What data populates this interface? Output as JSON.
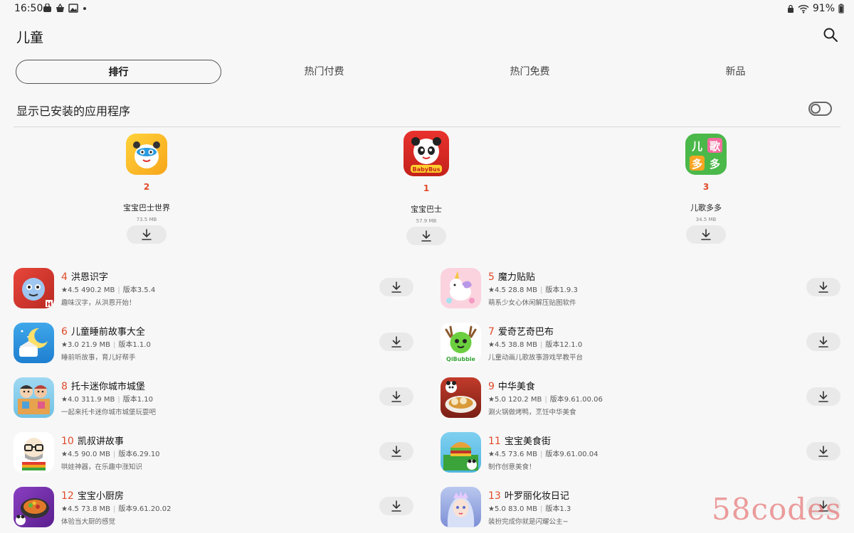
{
  "status_bar": {
    "time": "16:50",
    "battery": "91%"
  },
  "header": {
    "title": "儿童"
  },
  "tabs": [
    {
      "label": "排行",
      "active": true
    },
    {
      "label": "热门付费",
      "active": false
    },
    {
      "label": "热门免费",
      "active": false
    },
    {
      "label": "新品",
      "active": false
    }
  ],
  "toggle_row": {
    "label": "显示已安装的应用程序",
    "enabled": false
  },
  "top3": [
    {
      "rank": "2",
      "name": "宝宝巴士世界",
      "size": "73.5 MB"
    },
    {
      "rank": "1",
      "name": "宝宝巴士",
      "size": "57.9 MB"
    },
    {
      "rank": "3",
      "name": "儿歌多多",
      "size": "34.5 MB"
    }
  ],
  "list": [
    {
      "rank": "4",
      "name": "洪恩识字",
      "rating": "★4.5",
      "size": "490.2 MB",
      "version": "版本3.5.4",
      "desc": "趣味汉字，从洪恩开始！"
    },
    {
      "rank": "5",
      "name": "魔力贴贴",
      "rating": "★4.5",
      "size": "28.8 MB",
      "version": "版本1.9.3",
      "desc": "萌系少女心休闲解压贴图软件"
    },
    {
      "rank": "6",
      "name": "儿童睡前故事大全",
      "rating": "★3.0",
      "size": "21.9 MB",
      "version": "版本1.1.0",
      "desc": "睡前听故事，育儿好帮手"
    },
    {
      "rank": "7",
      "name": "爱奇艺奇巴布",
      "rating": "★4.5",
      "size": "38.8 MB",
      "version": "版本12.1.0",
      "desc": "儿童动画儿歌故事游戏早教平台"
    },
    {
      "rank": "8",
      "name": "托卡迷你城市城堡",
      "rating": "★4.0",
      "size": "311.9 MB",
      "version": "版本1.10",
      "desc": "一起来托卡迷你城市城堡玩耍吧"
    },
    {
      "rank": "9",
      "name": "中华美食",
      "rating": "★5.0",
      "size": "120.2 MB",
      "version": "版本9.61.00.06",
      "desc": "涮火锅做烤鸭，烹饪中华美食"
    },
    {
      "rank": "10",
      "name": "凯叔讲故事",
      "rating": "★4.5",
      "size": "90.0 MB",
      "version": "版本6.29.10",
      "desc": "哄娃神器，在乐趣中涨知识"
    },
    {
      "rank": "11",
      "name": "宝宝美食街",
      "rating": "★4.5",
      "size": "73.6 MB",
      "version": "版本9.61.00.04",
      "desc": "制作创意美食！"
    },
    {
      "rank": "12",
      "name": "宝宝小厨房",
      "rating": "★4.5",
      "size": "73.8 MB",
      "version": "版本9.61.20.02",
      "desc": "体验当大厨的感觉"
    },
    {
      "rank": "13",
      "name": "叶罗丽化妆日记",
      "rating": "★5.0",
      "size": "83.0 MB",
      "version": "版本1.3",
      "desc": "装扮完成你就是闪耀公主~"
    }
  ],
  "watermark": "58codes"
}
